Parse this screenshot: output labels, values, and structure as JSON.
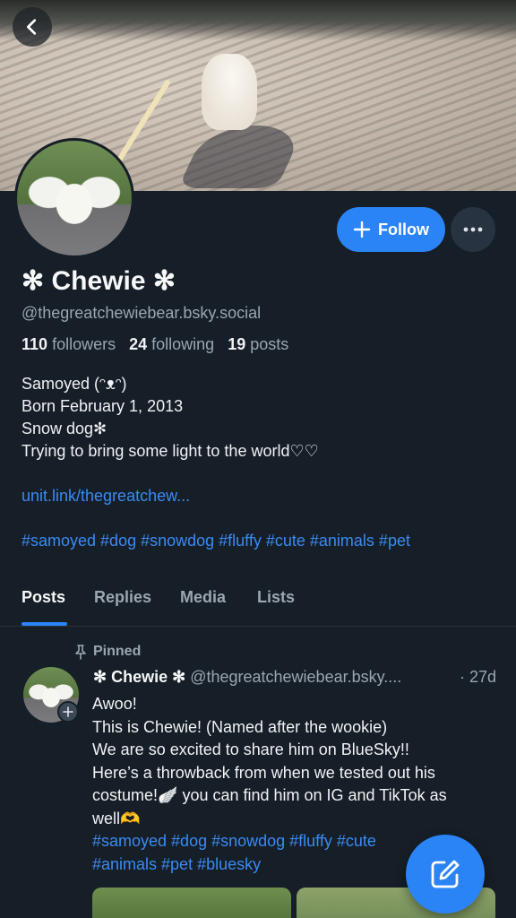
{
  "profile": {
    "display_name": "✻ Chewie ✻",
    "handle": "@thegreatchewiebear.bsky.social",
    "followers_count": "110",
    "followers_label": "followers",
    "following_count": "24",
    "following_label": "following",
    "posts_count": "19",
    "posts_label": "posts",
    "follow_label": "Follow",
    "bio_lines": [
      "Samoyed (ᵔᴥᵔ)",
      "Born February 1, 2013",
      "Snow dog✻",
      "Trying to bring some light to the world♡♡"
    ],
    "link": "unit.link/thegreatchew...",
    "hashtags": "#samoyed #dog #snowdog #fluffy #cute #animals #pet"
  },
  "tabs": [
    {
      "label": "Posts",
      "active": true
    },
    {
      "label": "Replies",
      "active": false
    },
    {
      "label": "Media",
      "active": false
    },
    {
      "label": "Lists",
      "active": false
    }
  ],
  "post": {
    "pinned_label": "Pinned",
    "author": "✻ Chewie ✻",
    "handle": "@thegreatchewiebear.bsky....",
    "time": "· 27d",
    "lines": [
      "Awoo!",
      "This is Chewie! (Named after the wookie)",
      "We are so excited to share him on BlueSky!!",
      "Here’s a throwback from when we tested out his",
      "costume!🪽 you can find him on IG and TikTok as",
      "well🫶"
    ],
    "hashtag_lines": [
      "#samoyed #dog #snowdog #fluffy #cute",
      "#animals #pet #bluesky"
    ]
  },
  "colors": {
    "background": "#161e27",
    "accent": "#2b84f5",
    "link": "#3a8bf2",
    "muted_text": "#9aa6b2"
  },
  "icons": {
    "back": "chevron-left-icon",
    "follow_plus": "plus-icon",
    "more": "ellipsis-icon",
    "pinned": "pin-icon",
    "compose": "compose-icon"
  }
}
